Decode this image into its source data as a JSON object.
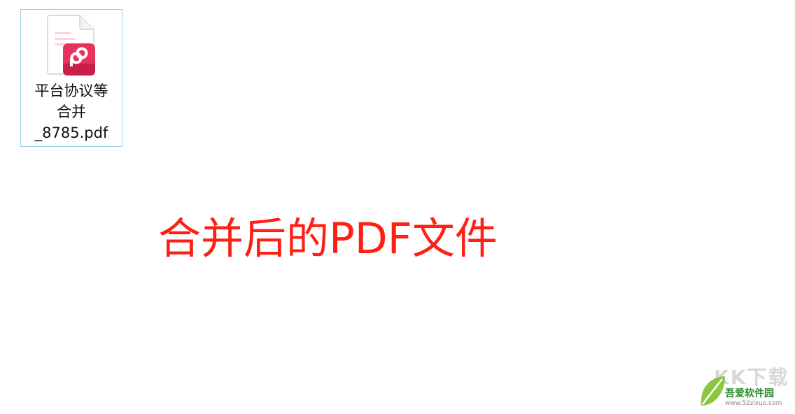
{
  "desktop": {
    "file": {
      "name": "平台协议等\n合并\n_8785.pdf",
      "icon": "wps-pdf-file-icon",
      "accent_color": "#e8335f"
    }
  },
  "caption": {
    "text": "合并后的PDF文件",
    "color": "#ff2015"
  },
  "watermark": {
    "brand": "KK下载",
    "site_name": "吾爱软件园",
    "url": "www.52zixue.com",
    "leaf_color": "#8cc63f"
  }
}
